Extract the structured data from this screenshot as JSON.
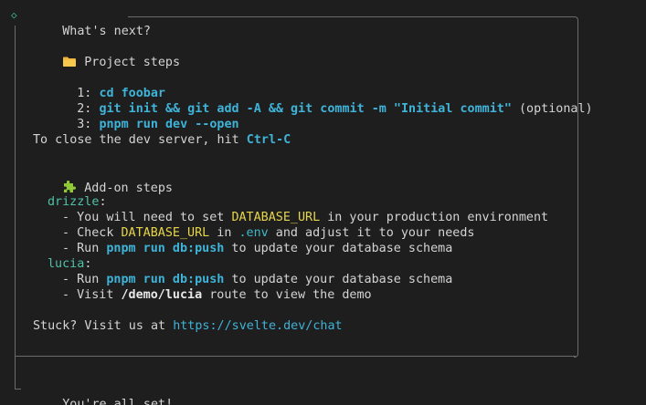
{
  "header": {
    "title": "What's next?"
  },
  "project_steps": {
    "heading": "Project steps",
    "icon": "folder-icon",
    "steps": [
      {
        "num": "1:",
        "command": "cd foobar",
        "note": ""
      },
      {
        "num": "2:",
        "command": "git init && git add -A && git commit -m \"Initial commit\"",
        "note": "(optional)"
      },
      {
        "num": "3:",
        "command": "pnpm run dev --open",
        "note": ""
      }
    ]
  },
  "close_hint": {
    "text": "To close the dev server, hit ",
    "key": "Ctrl-C"
  },
  "addon_steps": {
    "heading": "Add-on steps",
    "icon": "puzzle-icon",
    "drizzle": {
      "name": "drizzle",
      "line1_a": "- You will need to set ",
      "line1_b": "DATABASE_URL",
      "line1_c": " in your production environment",
      "line2_a": "- Check ",
      "line2_b": "DATABASE_URL",
      "line2_c": " in ",
      "line2_d": ".env",
      "line2_e": " and adjust it to your needs",
      "line3_a": "- Run ",
      "line3_b": "pnpm run db:push",
      "line3_c": " to update your database schema"
    },
    "lucia": {
      "name": "lucia",
      "line1_a": "- Run ",
      "line1_b": "pnpm run db:push",
      "line1_c": " to update your database schema",
      "line2_a": "- Visit ",
      "line2_b": "/demo/lucia",
      "line2_c": " route to view the demo"
    }
  },
  "stuck": {
    "text": "Stuck? Visit us at ",
    "link": "https://svelte.dev/chat"
  },
  "footer": {
    "text": "You're all set!"
  },
  "colors": {
    "background": "#1e1e1e",
    "command": "#3fb3d8",
    "env_var": "#e6d44a",
    "addon_name": "#4fc1a6",
    "border": "#6b6b6b"
  }
}
